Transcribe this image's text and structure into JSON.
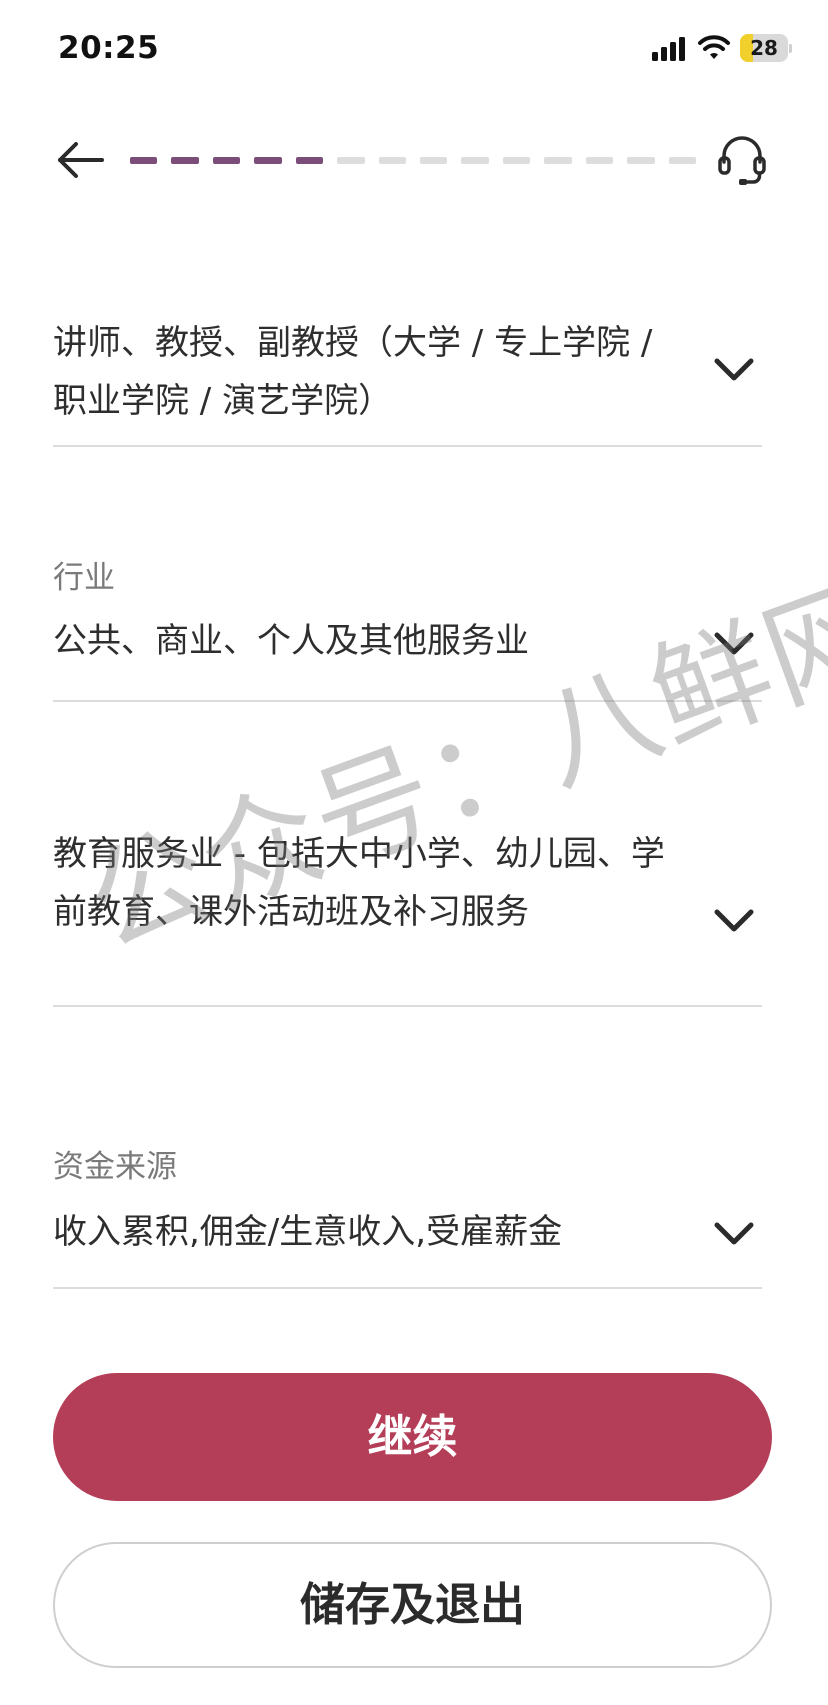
{
  "status_bar": {
    "time": "20:25",
    "battery_level": "28",
    "battery_fraction": 0.28,
    "icons": [
      "signal-icon",
      "wifi-icon",
      "battery-icon"
    ]
  },
  "header": {
    "back_icon": "arrow-left-icon",
    "support_icon": "headset-icon",
    "progress": {
      "completed_steps": 5,
      "total_steps": 14
    }
  },
  "form": {
    "occupation": {
      "value": "讲师、教授、副教授（大学 / 专上学院 / 职业学院 / 演艺学院）"
    },
    "industry": {
      "label": "行业",
      "value": "公共、商业、个人及其他服务业"
    },
    "sub_industry": {
      "value": "教育服务业 - 包括大中小学、幼儿园、学前教育、课外活动班及补习服务"
    },
    "source_of_funds": {
      "label": "资金来源",
      "value": "收入累积,佣金/生意收入,受雇薪金"
    }
  },
  "actions": {
    "continue_label": "继续",
    "save_exit_label": "储存及退出"
  },
  "watermark": "公众号：八鲜网",
  "colors": {
    "primary": "#b43e58",
    "progress_active": "#7a4e78",
    "progress_inactive": "#dddddd",
    "battery": "#f2d02b"
  }
}
